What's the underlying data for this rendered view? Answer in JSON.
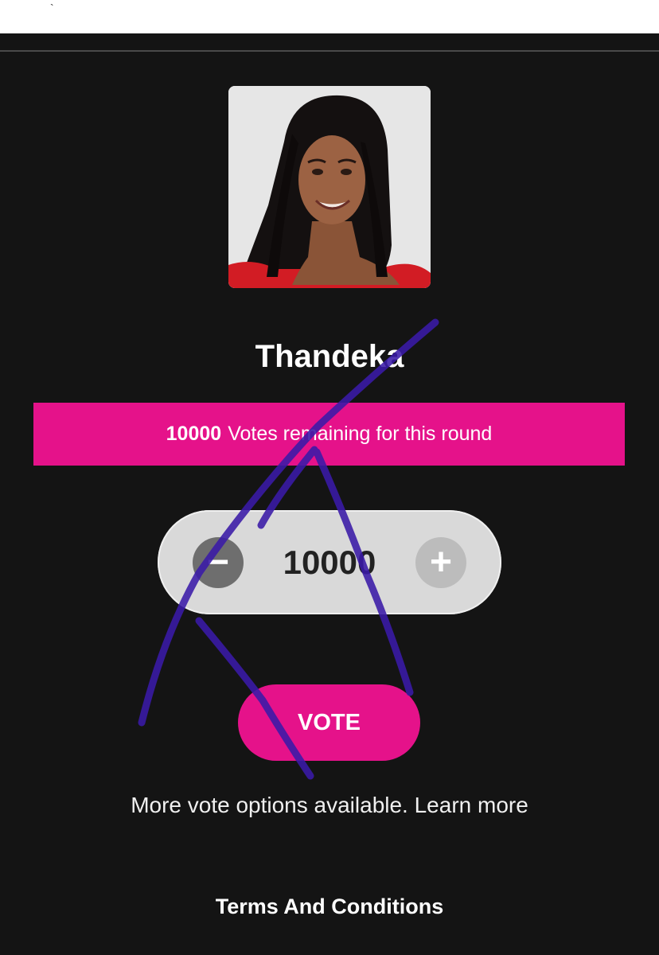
{
  "top_strip": {
    "mark": "`"
  },
  "contestant": {
    "name": "Thandeka",
    "photo_alt": "contestant-portrait"
  },
  "banner": {
    "count": "10000",
    "text": "Votes remaining for this round"
  },
  "stepper": {
    "minus_label": "−",
    "value": "10000",
    "plus_label": "+"
  },
  "vote_button": {
    "label": "VOTE"
  },
  "more_options": {
    "text": "More vote options available. Learn more"
  },
  "footer": {
    "terms_label": "Terms And Conditions"
  },
  "colors": {
    "background": "#141414",
    "accent_pink": "#e5128a",
    "stepper_bg": "#d9d9d9",
    "scribble": "#3a1aa8"
  },
  "icons": [
    "minus-icon",
    "plus-icon"
  ]
}
